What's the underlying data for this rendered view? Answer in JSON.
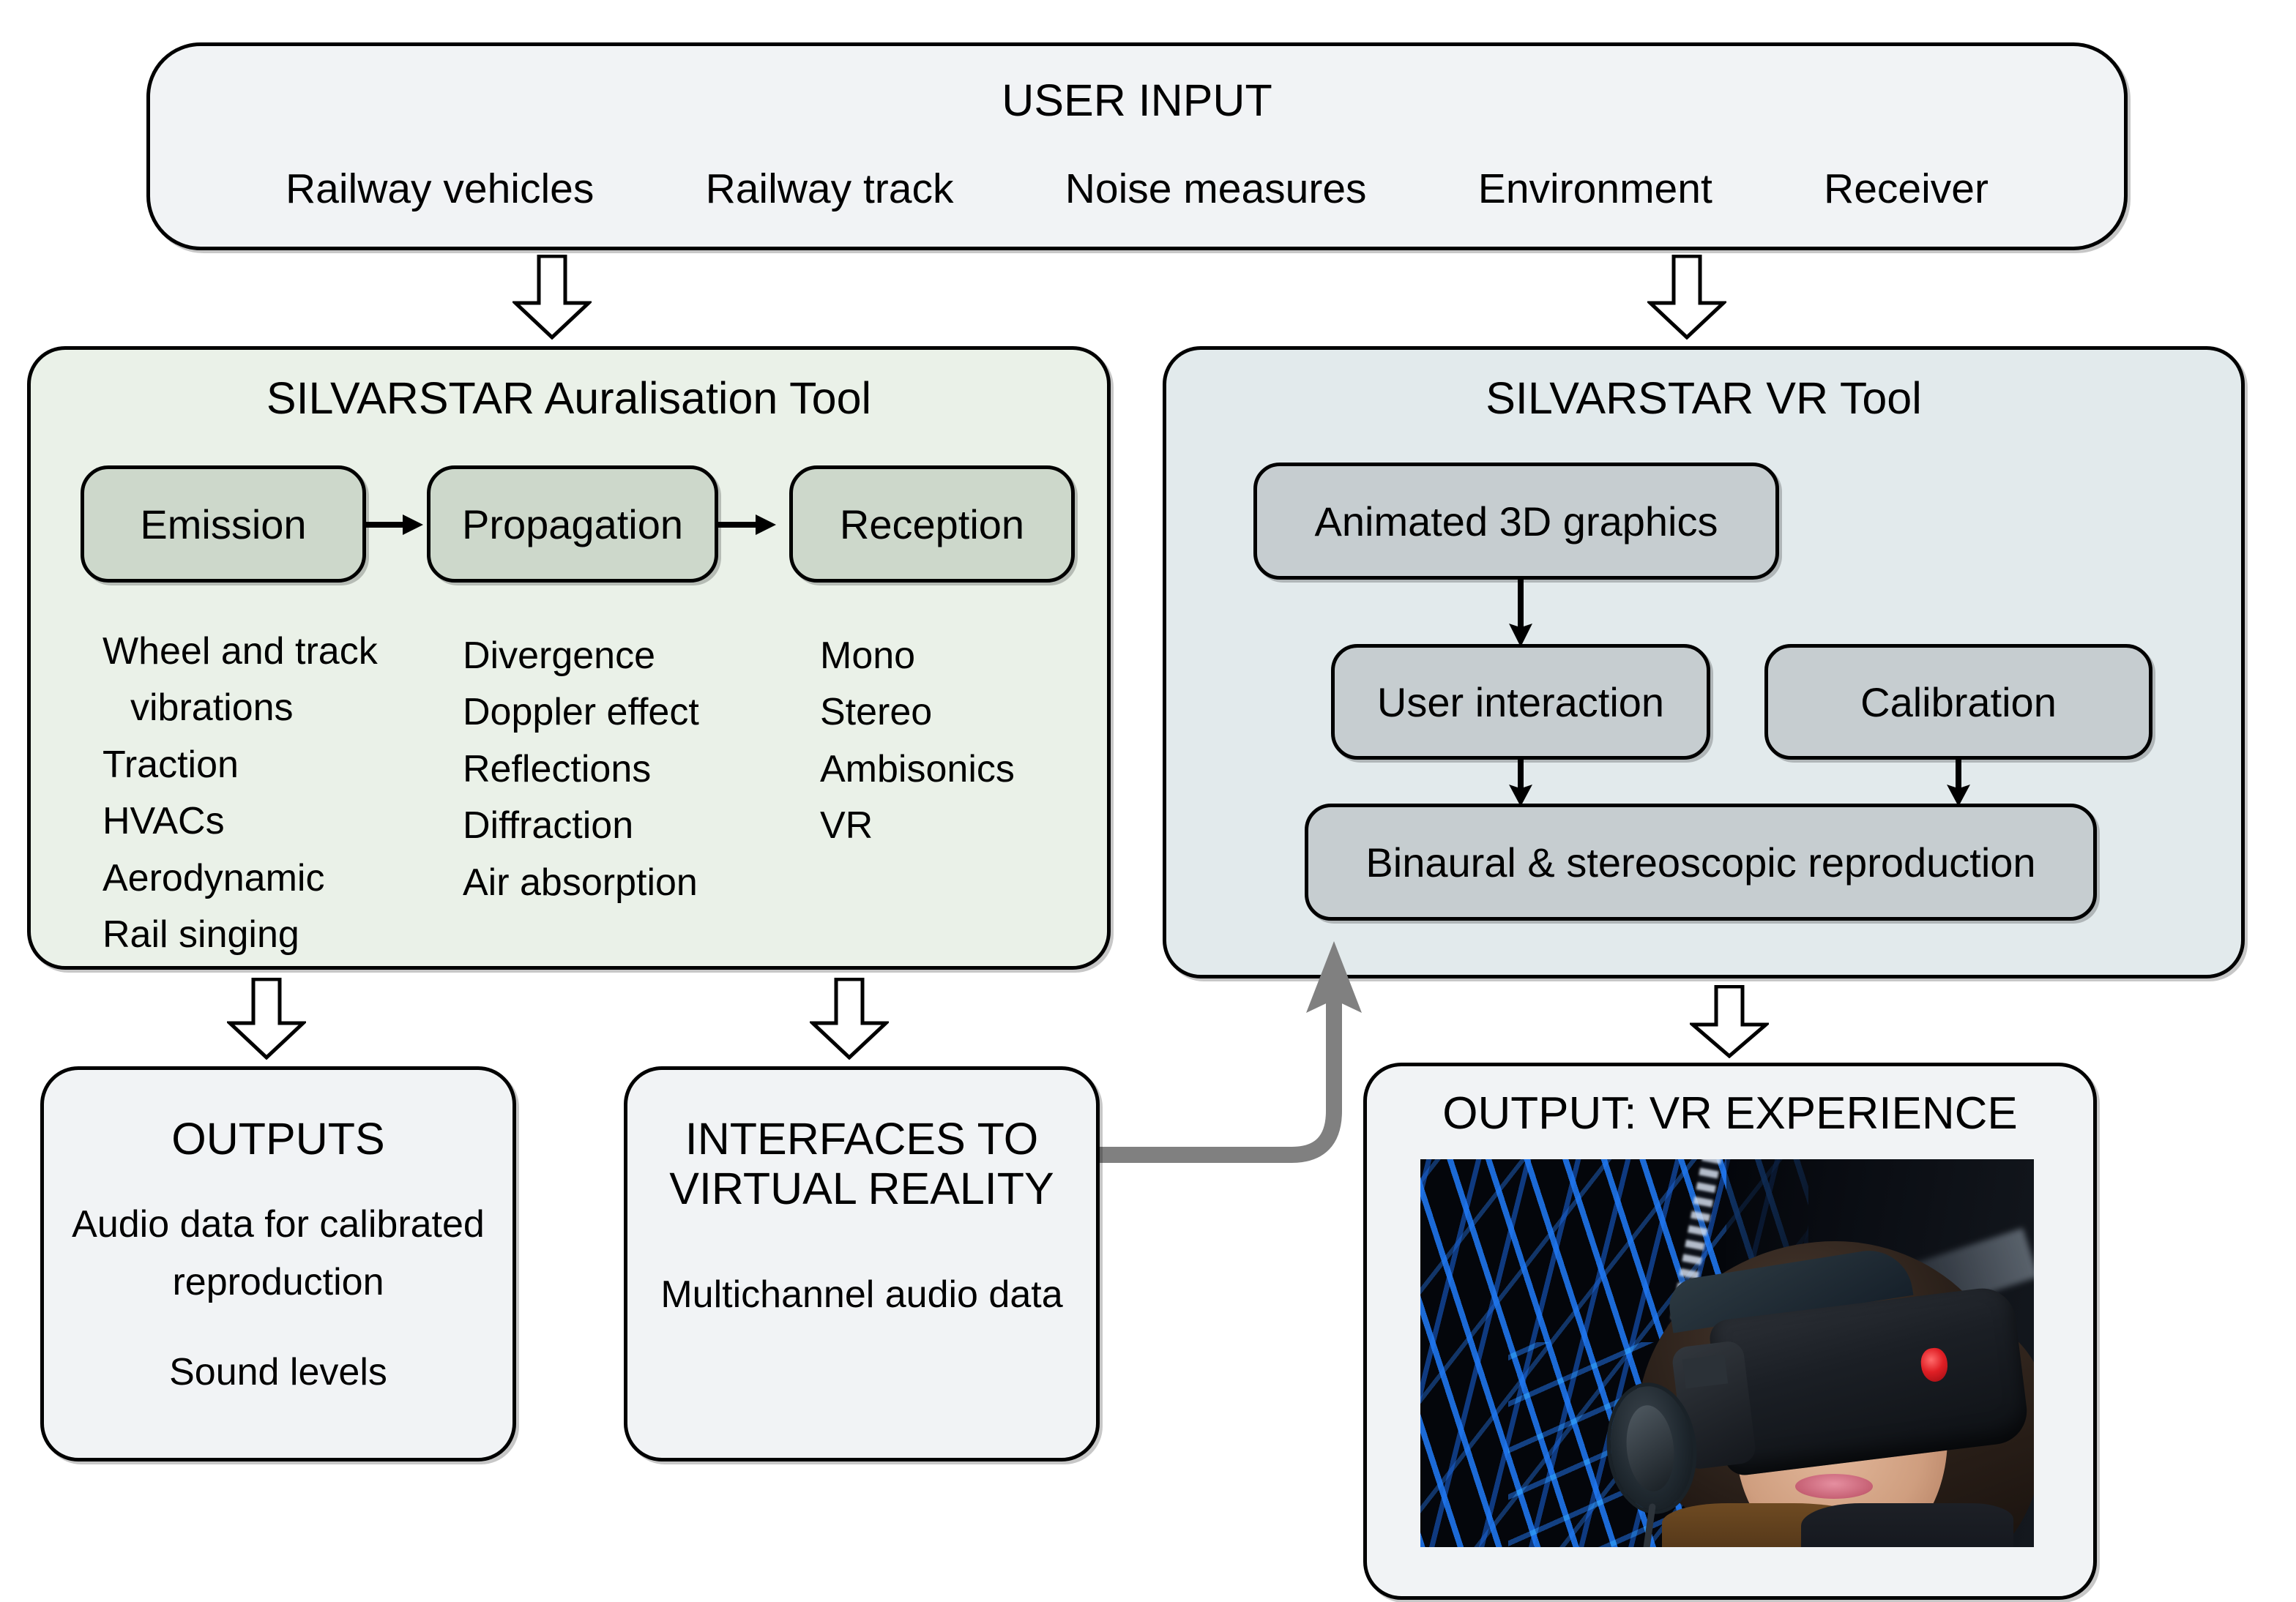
{
  "colors": {
    "panel_neutral_fill": "#f1f3f5",
    "auralisation_fill": "#eaf1e8",
    "auralisation_chip_fill": "#cdd8cb",
    "vr_fill": "#e2eaec",
    "vr_chip_fill": "#c6cdd0",
    "outline": "#000000",
    "connector_grey": "#808080",
    "photo_accent_blue": "#1f78f5",
    "photo_indicator_red": "#e01f25"
  },
  "user_input": {
    "title": "USER INPUT",
    "items": [
      "Railway vehicles",
      "Railway track",
      "Noise measures",
      "Environment",
      "Receiver"
    ]
  },
  "auralisation": {
    "title": "SILVARSTAR Auralisation Tool",
    "stages": [
      {
        "label": "Emission"
      },
      {
        "label": "Propagation"
      },
      {
        "label": "Reception"
      }
    ],
    "columns": [
      {
        "stage": "Emission",
        "items": [
          "Wheel and track",
          "vibrations",
          "Traction",
          "HVACs",
          "Aerodynamic",
          "Rail singing"
        ]
      },
      {
        "stage": "Propagation",
        "items": [
          "Divergence",
          "Doppler effect",
          "Reflections",
          "Diffraction",
          "Air absorption"
        ]
      },
      {
        "stage": "Reception",
        "items": [
          "Mono",
          "Stereo",
          "Ambisonics",
          "VR"
        ]
      }
    ]
  },
  "vr_tool": {
    "title": "SILVARSTAR VR Tool",
    "blocks": [
      {
        "label": "Animated 3D graphics"
      },
      {
        "label": "User interaction"
      },
      {
        "label": "Calibration"
      },
      {
        "label": "Binaural & stereoscopic reproduction"
      }
    ]
  },
  "outputs": {
    "title": "OUTPUTS",
    "lines": [
      "Audio data for calibrated",
      "reproduction",
      "Sound levels"
    ]
  },
  "interfaces": {
    "title_line1": "INTERFACES TO",
    "title_line2": "VIRTUAL REALITY",
    "lines": [
      "Multichannel audio data"
    ]
  },
  "vr_output": {
    "title": "OUTPUT: VR EXPERIENCE",
    "photo_alt": "woman-wearing-vr-headset-photo"
  },
  "icons": {
    "arrow_down_outline": "arrow-down-outline-icon",
    "arrow_right_solid": "arrow-right-solid-icon",
    "arrow_down_solid": "arrow-down-solid-icon",
    "elbow_arrow_up": "elbow-arrow-up-icon"
  }
}
